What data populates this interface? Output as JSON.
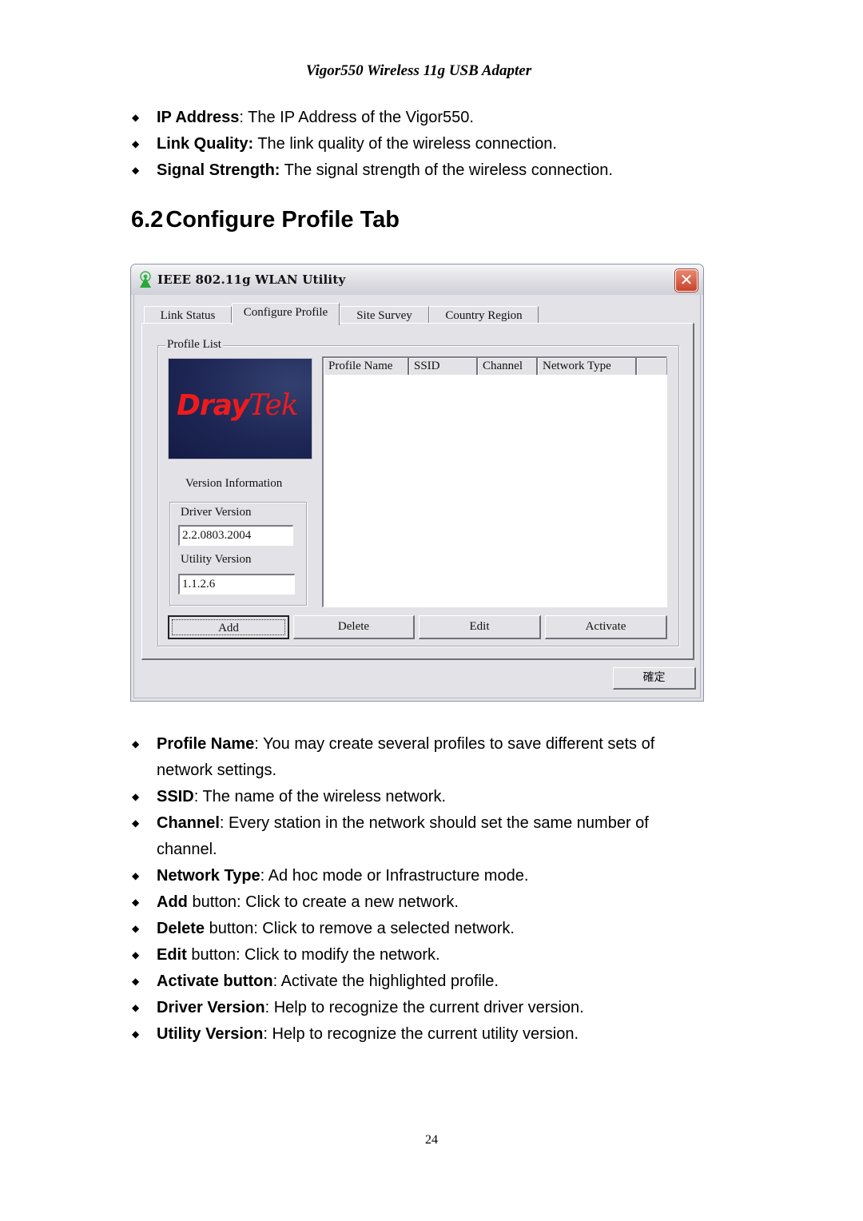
{
  "page_header": "Vigor550 Wireless 11g USB Adapter",
  "top_bullets": [
    {
      "term": "IP Address",
      "desc": ": The IP Address of the Vigor550."
    },
    {
      "term": "Link Quality:",
      "desc": " The link quality of the wireless connection."
    },
    {
      "term": "Signal Strength:",
      "desc": " The signal strength of the wireless connection."
    }
  ],
  "section": {
    "number": "6.2",
    "title": "Configure Profile Tab"
  },
  "window": {
    "title": "IEEE 802.11g WLAN Utility",
    "app_icon": "wireless-antenna-icon",
    "close_icon": "close-icon",
    "tabs": [
      {
        "label": "Link Status",
        "active": false
      },
      {
        "label": "Configure Profile",
        "active": true
      },
      {
        "label": "Site Survey",
        "active": false
      },
      {
        "label": "Country Region",
        "active": false
      }
    ],
    "profile_list_label": "Profile List",
    "logo_text": {
      "part1": "Dray",
      "part2": "Tek"
    },
    "version_information_label": "Version Information",
    "driver_version_label": "Driver Version",
    "driver_version_value": "2.2.0803.2004",
    "utility_version_label": "Utility Version",
    "utility_version_value": "1.1.2.6",
    "list_columns": [
      "Profile Name",
      "SSID",
      "Channel",
      "Network Type"
    ],
    "list_rows": [],
    "buttons": {
      "add": "Add",
      "delete": "Delete",
      "edit": "Edit",
      "activate": "Activate"
    },
    "ok_button": "確定"
  },
  "bottom_bullets": [
    {
      "term": "Profile Name",
      "desc": ": You may create several profiles to save different sets of network settings."
    },
    {
      "term": "SSID",
      "desc": ": The name of the wireless network."
    },
    {
      "term": "Channel",
      "desc": ": Every station in the network should set the same number of channel."
    },
    {
      "term": "Network Type",
      "desc": ": Ad hoc mode or Infrastructure mode."
    },
    {
      "term": "Add",
      "desc": " button: Click to create a new network."
    },
    {
      "term": "Delete",
      "desc": " button: Click to remove a selected network."
    },
    {
      "term": "Edit",
      "desc": " button: Click to modify the network."
    },
    {
      "term": "Activate button",
      "desc": ": Activate the highlighted profile."
    },
    {
      "term": "Driver Version",
      "desc": ": Help to recognize the current driver version."
    },
    {
      "term": "Utility Version",
      "desc": ": Help to recognize the current utility version."
    }
  ],
  "bullet_glyph": "◆",
  "page_number": "24"
}
